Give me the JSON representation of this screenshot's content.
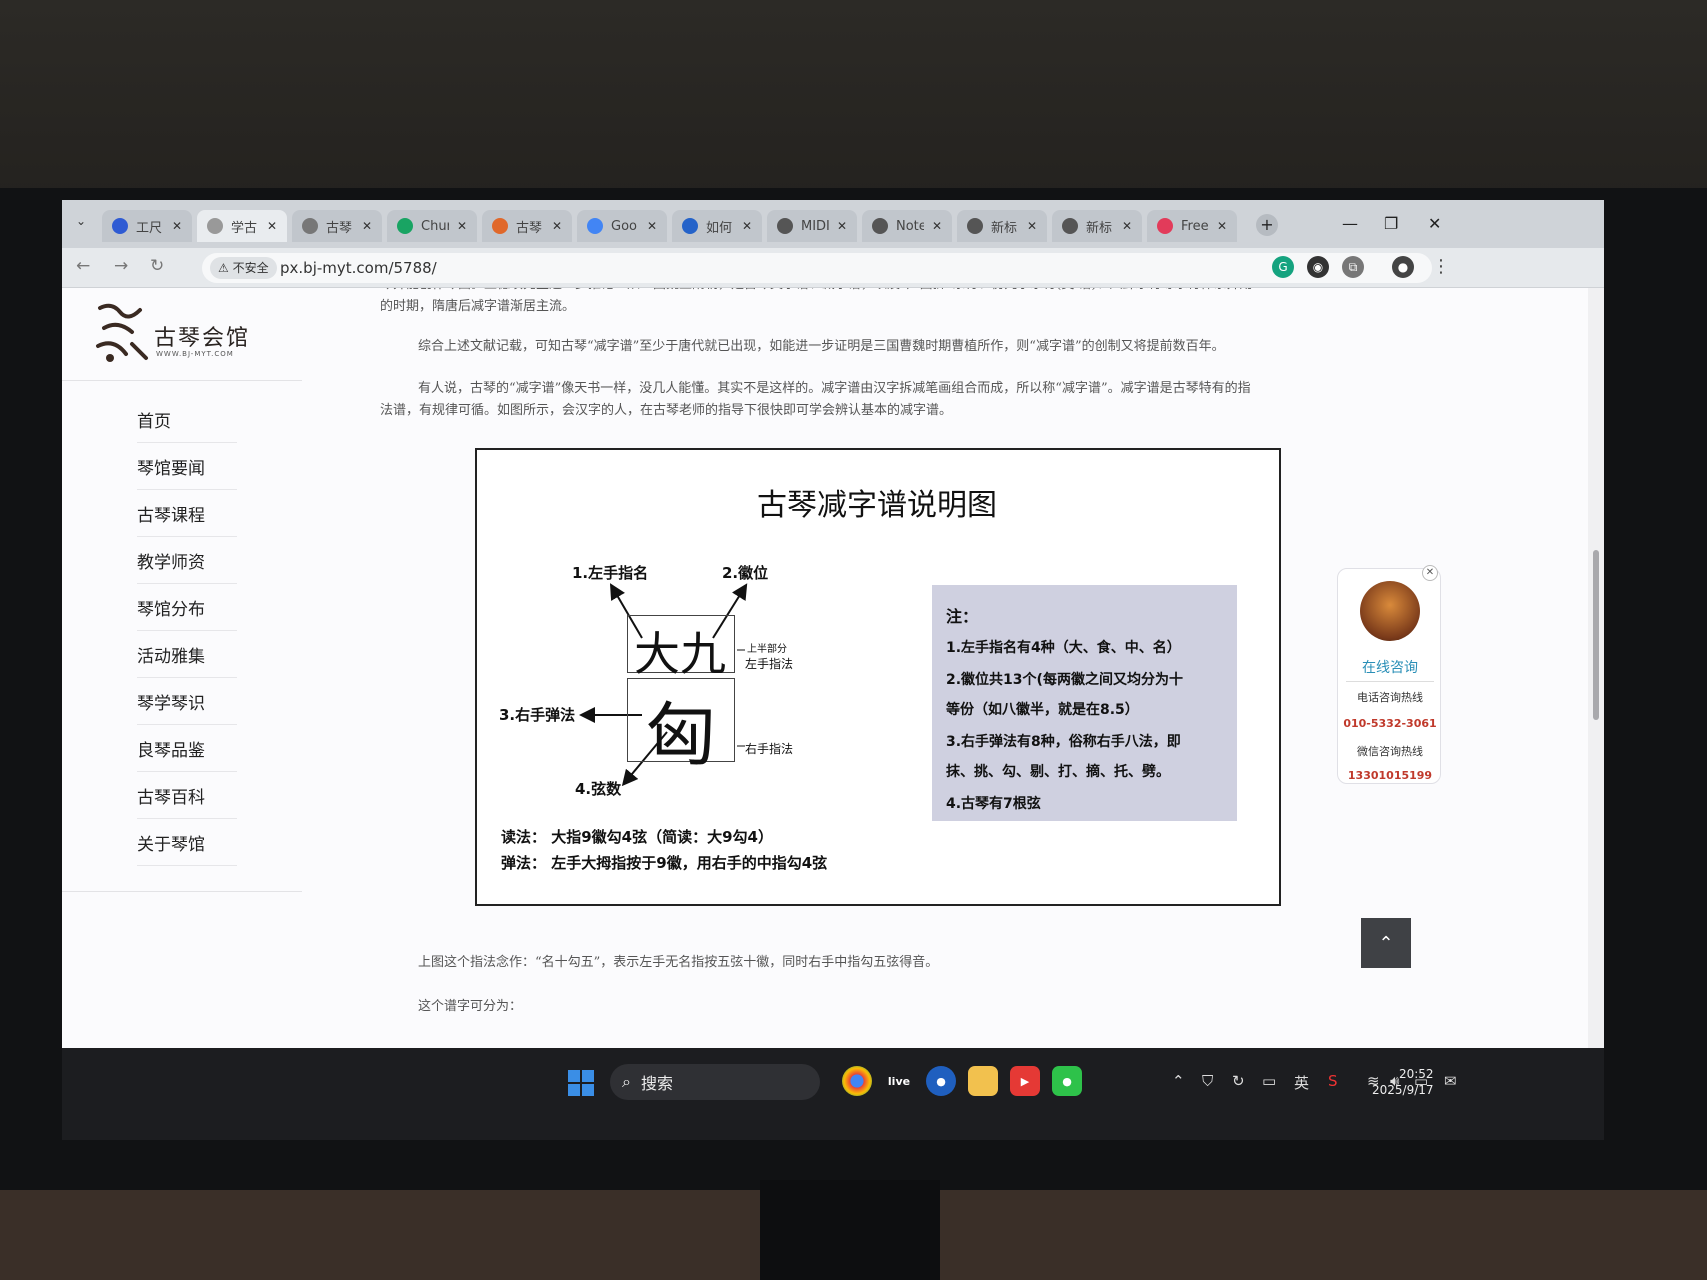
{
  "browser": {
    "tabs": [
      {
        "label": "工尺",
        "icon": "baidu-icon",
        "color": "#2f5bd3",
        "active": false
      },
      {
        "label": "学古",
        "icon": "",
        "color": "#999999",
        "active": true
      },
      {
        "label": "古琴",
        "icon": "grid-icon",
        "color": "#777777",
        "active": false
      },
      {
        "label": "Chur",
        "icon": "chatgpt-icon",
        "color": "#19a463",
        "active": false
      },
      {
        "label": "古琴",
        "icon": "app-icon",
        "color": "#e0682a",
        "active": false
      },
      {
        "label": "Goo",
        "icon": "google-icon",
        "color": "#4285f4",
        "active": false
      },
      {
        "label": "如何",
        "icon": "n-icon",
        "color": "#2563c9",
        "active": false
      },
      {
        "label": "MIDI",
        "icon": "globe-icon",
        "color": "#555555",
        "active": false
      },
      {
        "label": "Note",
        "icon": "globe-icon",
        "color": "#555555",
        "active": false
      },
      {
        "label": "新标",
        "icon": "globe-icon",
        "color": "#555555",
        "active": false
      },
      {
        "label": "新标",
        "icon": "globe-icon",
        "color": "#555555",
        "active": false
      },
      {
        "label": "Free",
        "icon": "app-icon",
        "color": "#e23b5a",
        "active": false
      }
    ],
    "security_label": "不安全",
    "url": "px.bj-myt.com/5788/"
  },
  "site": {
    "logo_name": "古琴会馆",
    "logo_url": "WWW.BJ-MYT.COM",
    "menu": [
      "首页",
      "琴馆要闻",
      "古琴课程",
      "教学师资",
      "琴馆分布",
      "活动雅集",
      "琴学琴识",
      "良琴品鉴",
      "古琴百科",
      "关于琴馆"
    ]
  },
  "article": {
    "para0": "琴并能创作琴曲。王德埙先生进一步推论：从三国魏至隋朝，是古琴文字谱、减字谱，以及“声曲折”东符、仿梵字乐符(契 谱)、八卦乐符等乐符体系并用",
    "para0b": "的时期，隋唐后减字谱渐居主流。",
    "para1": "综合上述文献记载，可知古琴“减字谱”至少于唐代就已出现，如能进一步证明是三国曹魏时期曹植所作，则“减字谱”的创制又将提前数百年。",
    "para2a": "有人说，古琴的“减字谱”像天书一样，没几人能懂。其实不是这样的。减字谱由汉字拆减笔画组合而成，所以称“减字谱”。减字谱是古琴特有的指",
    "para2b": "法谱，有规律可循。如图所示，会汉字的人，在古琴老师的指导下很快即可学会辨认基本的减字谱。",
    "para3": "上图这个指法念作：“名十勾五”，表示左手无名指按五弦十徽，同时右手中指勾五弦得音。",
    "para4": "这个谱字可分为："
  },
  "figure": {
    "title": "古琴减字谱说明图",
    "upper_chars": "大九",
    "lower_char": "匈",
    "label_left_finger": "1.左手指名",
    "label_hui": "2.徽位",
    "label_right_tech": "3.右手弹法",
    "label_string": "4.弦数",
    "label_upper_part": "上半部分",
    "label_left_fingering": "左手指法",
    "label_right_fingering": "右手指法",
    "read_label": "读法：",
    "read_text": "大指9徽勾4弦（简读：大9勾4）",
    "play_label": "弹法：",
    "play_text": "左手大拇指按于9徽，用右手的中指勾4弦",
    "note_title": "注：",
    "notes": [
      "1.左手指名有4种（大、食、中、名）",
      "2.徽位共13个(每两徽之间又均分为十",
      "等份（如八徽半，就是在8.5）",
      "3.右手弹法有8种，俗称右手八法，即",
      "抹、挑、勾、剔、打、摘、托、劈。",
      "4.古琴有7根弦"
    ]
  },
  "consult": {
    "online": "在线咨询",
    "phone_label": "电话咨询热线",
    "phone": "010-5332-3061",
    "wechat_label": "微信咨询热线",
    "wechat": "13301015199"
  },
  "taskbar": {
    "search": "搜索",
    "ime": "英",
    "time": "20:52",
    "date": "2025/9/17"
  }
}
